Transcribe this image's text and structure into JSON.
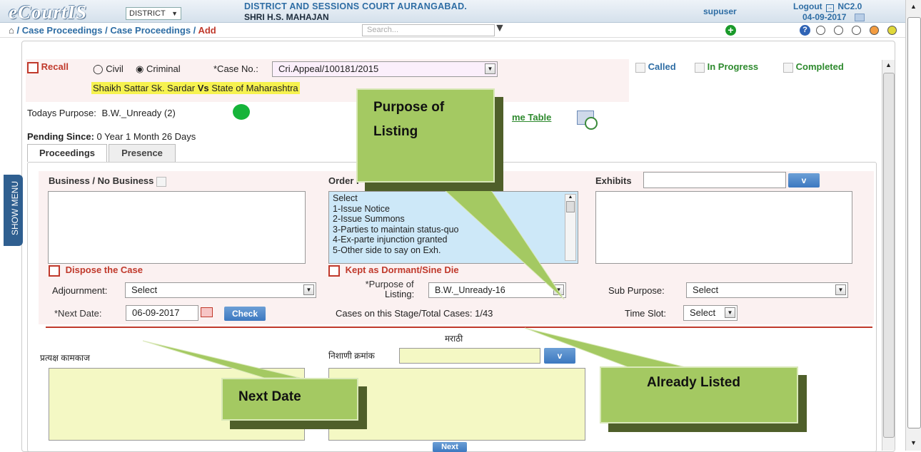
{
  "header": {
    "logo": "eCourtIS",
    "district_select": "DISTRICT",
    "court_name": "DISTRICT AND SESSIONS COURT AURANGABAD.",
    "judge_name": "SHRI H.S. MAHAJAN",
    "user": "supuser",
    "logout": "Logout",
    "version": "NC2.0",
    "date": "04-09-2017"
  },
  "breadcrumb": {
    "item1": "Case Proceedings",
    "item2": "Case Proceedings",
    "item3": "Add",
    "sep": "/"
  },
  "search": {
    "placeholder": "Search..."
  },
  "theme_colors": [
    "#ffffff",
    "#ffffff",
    "#ffffff",
    "#f39c40",
    "#e0d83a",
    "#3c6fb5",
    "#f3e060"
  ],
  "case": {
    "recall": "Recall",
    "civil": "Civil",
    "criminal": "Criminal",
    "case_no_label": "*Case No.:",
    "case_no_value": "Cri.Appeal/100181/2015",
    "parties_left": "Shaikh Sattar Sk. Sardar",
    "vs": "Vs",
    "parties_right": "State of Maharashtra",
    "called": "Called",
    "in_progress": "In Progress",
    "completed": "Completed",
    "todays_purpose_label": "Todays Purpose:",
    "todays_purpose_value": "B.W._Unready (2)",
    "time_table_fragment": "me Table",
    "pending_label": "Pending Since:",
    "pending_value": "0 Year 1 Month 26 Days"
  },
  "tabs": [
    "Proceedings",
    "Presence"
  ],
  "form": {
    "business_label": "Business / No Business",
    "order_label": "Order P",
    "exhibits_label": "Exhibits",
    "v_button": "v",
    "order_options": [
      "Select",
      "1-Issue Notice",
      "2-Issue Summons",
      "3-Parties to maintain status-quo",
      "4-Ex-parte injunction granted",
      "5-Other side to say on Exh."
    ],
    "dispose_label": "Dispose the Case",
    "dormant_label": "Kept as Dormant/Sine Die",
    "adjournment_label": "Adjournment:",
    "adjournment_value": "Select",
    "purpose_label_1": "*Purpose of",
    "purpose_label_2": "Listing:",
    "purpose_value": "B.W._Unready-16",
    "sub_purpose_label": "Sub Purpose:",
    "sub_purpose_value": "Select",
    "next_date_label": "*Next Date:",
    "next_date_value": "06-09-2017",
    "check_button": "Check",
    "cases_stage": "Cases on this Stage/Total Cases:  1/43",
    "time_slot_label": "Time Slot:",
    "time_slot_value": "Select",
    "marathi": "मराठी",
    "pratyaksh": "प्रत्यक्ष कामकाज",
    "nishani": "निशाणी क्रमांक",
    "next_button": "Next"
  },
  "side_menu": "SHOW MENU",
  "callouts": {
    "purpose": "Purpose of Listing",
    "next_date": "Next Date",
    "already_listed": "Already Listed"
  }
}
